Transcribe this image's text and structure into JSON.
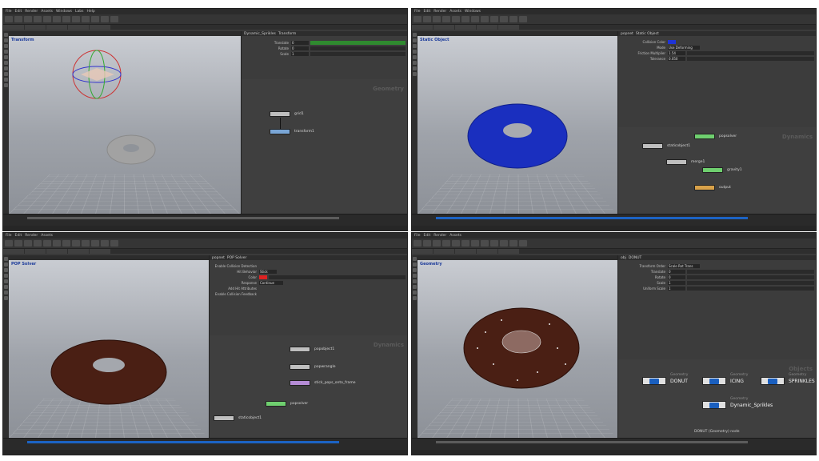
{
  "panels": [
    {
      "viewport_title": "Transform",
      "network_context": "Geometry",
      "path": "Dynamic_Sprikles",
      "params_title": "Transform",
      "params": [
        {
          "label": "Translate",
          "value": "0"
        },
        {
          "label": "Rotate",
          "value": "0"
        },
        {
          "label": "Scale",
          "value": "1"
        },
        {
          "label": "Shear",
          "value": "0"
        },
        {
          "label": "Uniform Scale",
          "value": "1"
        },
        {
          "label": "Pivot Translate",
          "value": ""
        },
        {
          "label": "Pre-Transform",
          "value": ""
        }
      ],
      "nodes": [
        "grid1",
        "transform1"
      ]
    },
    {
      "viewport_title": "Static Object",
      "network_context": "Dynamics",
      "path": "popnet",
      "params_title": "Static Object",
      "params": [
        {
          "label": "Collision Color",
          "value": ""
        },
        {
          "label": "Mode",
          "value": "Use Deforming"
        },
        {
          "label": "Friction Multiplier",
          "value": "1.54"
        },
        {
          "label": "Bounce",
          "value": ""
        },
        {
          "label": "Static Threshold",
          "value": ""
        },
        {
          "label": "Max Edge Deformation",
          "value": ""
        },
        {
          "label": "Tolerance",
          "value": "0.050"
        }
      ],
      "nodes": [
        "staticobject1",
        "popsolver",
        "merge1",
        "gravity1",
        "output"
      ]
    },
    {
      "viewport_title": "POP Solver",
      "network_context": "Dynamics",
      "path": "popnet",
      "params_title": "POP Solver",
      "params": [
        {
          "label": "Enable Collision Detection",
          "value": ""
        },
        {
          "label": "Hit Behavior",
          "value": "Stick"
        },
        {
          "label": "Color",
          "value": ""
        },
        {
          "label": "Response",
          "value": "Continue"
        },
        {
          "label": "Add Hit Attributes",
          "value": ""
        },
        {
          "label": "Enable Collision Feedback",
          "value": ""
        }
      ],
      "nodes": [
        "popobject1",
        "popwrangle",
        "stick_pops_onto_frame",
        "popsolver",
        "staticobject1"
      ]
    },
    {
      "viewport_title": "Geometry",
      "network_context": "Objects",
      "path": "obj",
      "params_title": "DONUT",
      "params": [
        {
          "label": "Transform Order",
          "value": "Scale Rot Trans"
        },
        {
          "label": "Translate",
          "value": "0"
        },
        {
          "label": "Rotate",
          "value": "0"
        },
        {
          "label": "Scale",
          "value": "1"
        },
        {
          "label": "Pivot Translate",
          "value": "0"
        },
        {
          "label": "Pivot Rotate",
          "value": "0"
        },
        {
          "label": "Uniform Scale",
          "value": "1"
        }
      ],
      "object_nodes": [
        {
          "type": "Geometry",
          "name": "DONUT"
        },
        {
          "type": "Geometry",
          "name": "ICING"
        },
        {
          "type": "Geometry",
          "name": "SPRINKLES"
        },
        {
          "type": "Geometry",
          "name": "Dynamic_Sprikles"
        }
      ],
      "status": "DONUT (Geometry) node"
    }
  ],
  "menu": [
    "File",
    "Edit",
    "Render",
    "Assets",
    "Windows",
    "Labs",
    "Help"
  ],
  "colors": {
    "donut_blue": "#1a2fbf",
    "donut_choc": "#4a1f14",
    "accent_green": "#3f9b3f",
    "timeline_blue": "#1c63c4"
  }
}
